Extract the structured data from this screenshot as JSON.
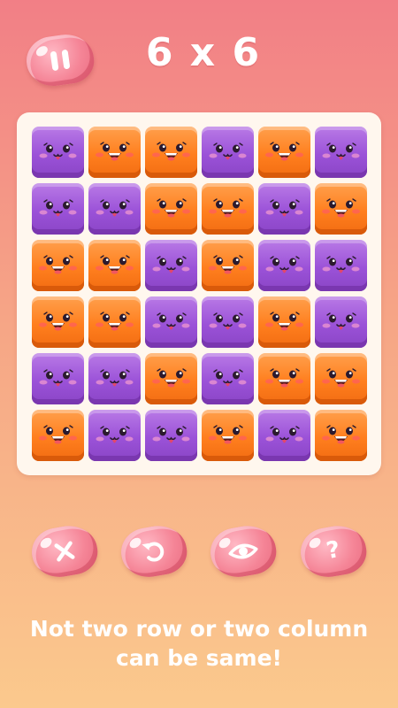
{
  "header": {
    "level_title": "6 x 6"
  },
  "colors": {
    "purple": "#9b52d8",
    "orange": "#ff7f1e",
    "button_pink": "#f58597"
  },
  "board": {
    "rows": 6,
    "cols": 6,
    "cells": [
      [
        "purple",
        "orange",
        "orange",
        "purple",
        "orange",
        "purple"
      ],
      [
        "purple",
        "purple",
        "orange",
        "orange",
        "purple",
        "orange"
      ],
      [
        "orange",
        "orange",
        "purple",
        "orange",
        "purple",
        "purple"
      ],
      [
        "orange",
        "orange",
        "purple",
        "purple",
        "orange",
        "purple"
      ],
      [
        "purple",
        "purple",
        "orange",
        "purple",
        "orange",
        "orange"
      ],
      [
        "orange",
        "purple",
        "purple",
        "orange",
        "purple",
        "orange"
      ]
    ]
  },
  "controls": {
    "buttons": [
      {
        "name": "clear-button",
        "icon": "x-icon"
      },
      {
        "name": "undo-button",
        "icon": "undo-icon"
      },
      {
        "name": "reveal-button",
        "icon": "eye-icon"
      },
      {
        "name": "help-button",
        "icon": "question-icon",
        "glyph": "?"
      }
    ]
  },
  "hint": {
    "line1": "Not two row or two column",
    "line2": "can be same!"
  }
}
